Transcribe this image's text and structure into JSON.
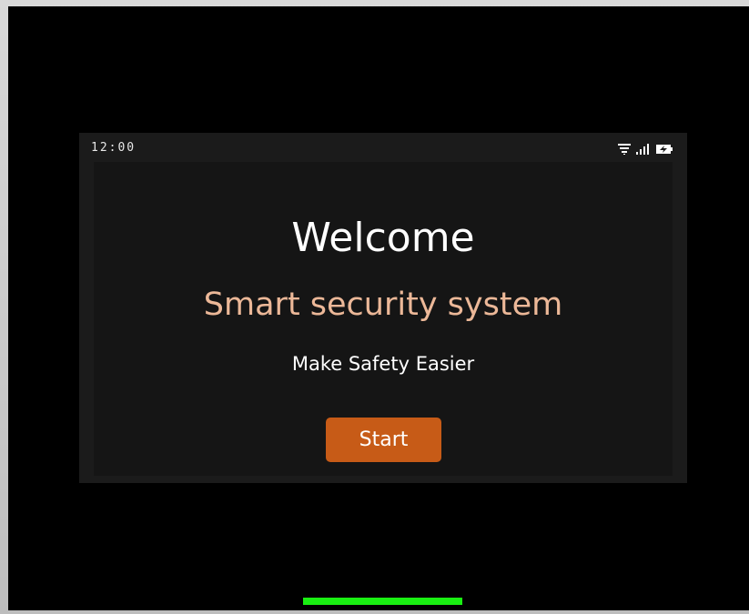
{
  "status_bar": {
    "time": "12:00",
    "icons": [
      "wifi-icon",
      "signal-icon",
      "battery-charging-icon"
    ]
  },
  "welcome": {
    "title": "Welcome",
    "product_name": "Smart security system",
    "tagline": "Make Safety Easier",
    "start_label": "Start"
  },
  "colors": {
    "accent": "#c75b17",
    "product_text": "#ecb898",
    "home_indicator": "#19ef12",
    "screen_bg": "#151515"
  }
}
